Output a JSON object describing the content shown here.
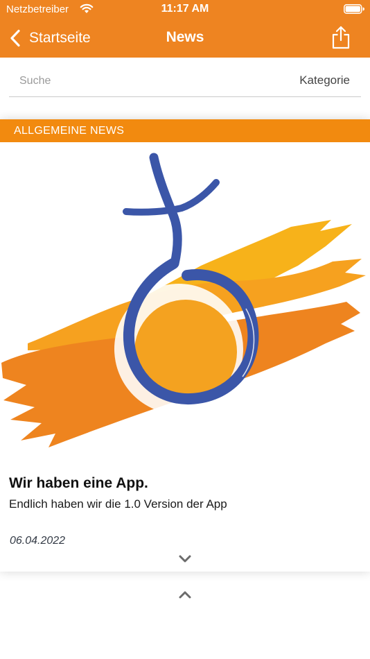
{
  "status_bar": {
    "carrier": "Netzbetreiber",
    "time": "11:17 AM",
    "wifi_icon": "wifi-icon",
    "battery_icon": "battery-icon"
  },
  "nav": {
    "back_label": "Startseite",
    "title": "News",
    "back_icon": "chevron-left-icon",
    "share_icon": "share-icon"
  },
  "search": {
    "placeholder": "Suche",
    "value": "",
    "category_label": "Kategorie"
  },
  "news_items": [
    {
      "category": "ALLGEMEINE NEWS",
      "image": "logo: blue female symbol over orange brush strokes",
      "title": "Wir haben eine App.",
      "teaser": "Endlich haben wir die 1.0 Version der App",
      "date": "06.04.2022",
      "expand_icon": "chevron-down-icon"
    }
  ],
  "collapse_icon": "chevron-up-icon",
  "colors": {
    "nav_background": "#ee8421",
    "category_banner": "#f28a0f",
    "logo_blue": "#3b56a8",
    "logo_yellow": "#f7b21a",
    "logo_orange": "#ee841f"
  }
}
